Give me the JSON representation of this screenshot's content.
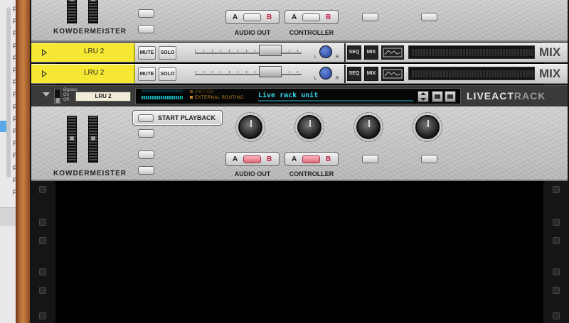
{
  "host": {
    "sidebar_letters": [
      "F",
      "F",
      "F",
      "F",
      "F",
      "F",
      "F",
      "F",
      "F",
      "F",
      "F",
      "F",
      "F",
      "F",
      "F",
      "F"
    ]
  },
  "kowdermeister_top": {
    "brand": "KOWDERMEISTER",
    "audio_out": {
      "a": "A",
      "b": "B",
      "label": "AUDIO OUT"
    },
    "controller": {
      "a": "A",
      "b": "B",
      "label": "CONTROLLER"
    }
  },
  "lru_channels": [
    {
      "name": "LRU 2",
      "mute": "MUTE",
      "solo": "SOLO",
      "pan_l": "L",
      "pan_r": "R",
      "seq": "SEQ",
      "mix": "MIX",
      "mix_label": "MIX"
    },
    {
      "name": "LRU 2",
      "mute": "MUTE",
      "solo": "SOLO",
      "pan_l": "L",
      "pan_r": "R",
      "seq": "SEQ",
      "mix": "MIX",
      "mix_label": "MIX"
    }
  ],
  "liveact_rack": {
    "bypass": "Bypass",
    "on": "On",
    "off": "Off",
    "device_tape": "LRU 2",
    "routing_options": [
      "MOTION",
      "EXTERNAL ROUTING"
    ],
    "unit_name": "Live rack unit",
    "logo_primary": "LIVEACT",
    "logo_secondary": "RACK"
  },
  "kowdermeister_bottom": {
    "brand": "KOWDERMEISTER",
    "start_playback": "START PLAYBACK",
    "audio_out": {
      "a": "A",
      "b": "B",
      "label": "AUDIO OUT"
    },
    "controller": {
      "a": "A",
      "b": "B",
      "label": "CONTROLLER"
    }
  },
  "colors": {
    "lru_name_bg": "#f5e732",
    "ab_active": "#e06a7d",
    "display_text": "#36d8ec",
    "display_option": "#c48a27"
  }
}
